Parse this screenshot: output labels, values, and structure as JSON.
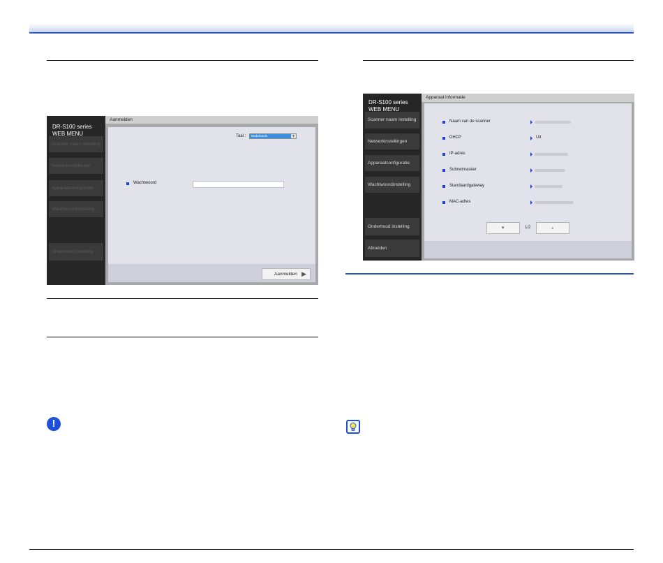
{
  "left_menu": {
    "brand_line1": "DR-S100 series",
    "brand_line2": "WEB MENU",
    "nav": [
      "Scanner naam instelling",
      "Netwerkinstellingen",
      "Apparaatconfiguratie",
      "Wachtwoordinstelling",
      "Onderhoud instelling"
    ],
    "title": "Aanmelden",
    "language_label": "Taal :",
    "language_value": "Nederlands",
    "password_label": "Wachtwoord",
    "login_button": "Aanmelden"
  },
  "right_menu": {
    "brand_line1": "DR-S100 series",
    "brand_line2": "WEB MENU",
    "nav": [
      "Scanner naam instelling",
      "Netwerkinstellingen",
      "Apparaatconfiguratie",
      "Wachtwoordinstelling",
      "Onderhoud instelling",
      "Afmelden"
    ],
    "title": "Apparaat informatie",
    "fields": [
      {
        "label": "Naam van de scanner",
        "value": ""
      },
      {
        "label": "DHCP",
        "value": "Uit"
      },
      {
        "label": "IP-adres",
        "value": ""
      },
      {
        "label": "Subnetmasker",
        "value": ""
      },
      {
        "label": "Standaardgateway",
        "value": ""
      },
      {
        "label": "MAC-adres",
        "value": ""
      }
    ],
    "page_indicator": "1/2"
  },
  "icons": {
    "caution": "exclamation-icon",
    "hint": "lightbulb-icon",
    "accent_color": "#2c55c4"
  }
}
